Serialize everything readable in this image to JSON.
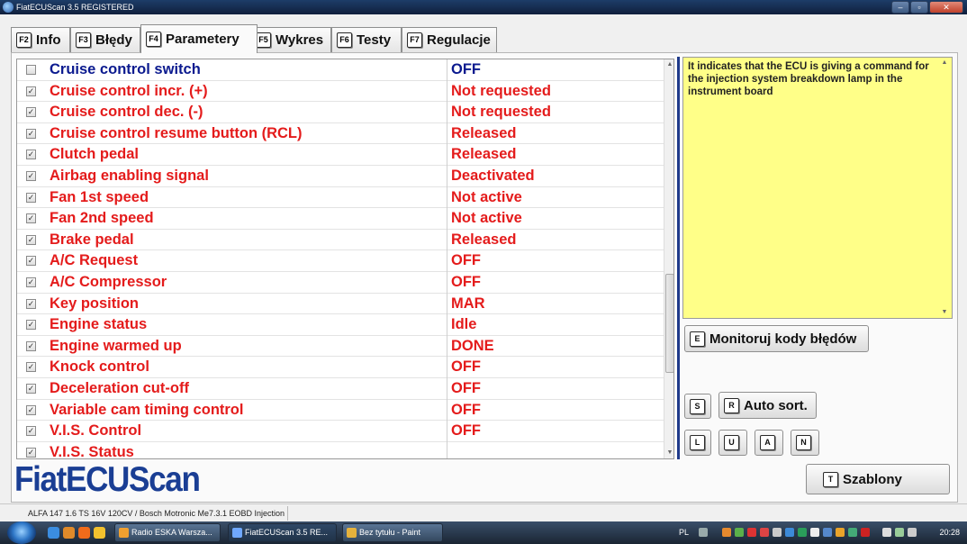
{
  "window": {
    "title": "FiatECUScan 3.5 REGISTERED",
    "controls": [
      "–",
      "▫",
      "✕"
    ]
  },
  "tabs": [
    {
      "key": "F2",
      "label": "Info"
    },
    {
      "key": "F3",
      "label": "Błędy"
    },
    {
      "key": "F4",
      "label": "Parametery"
    },
    {
      "key": "F5",
      "label": "Wykres"
    },
    {
      "key": "F6",
      "label": "Testy"
    },
    {
      "key": "F7",
      "label": "Regulacje"
    }
  ],
  "active_tab": "Parametery",
  "parameters": [
    {
      "name": "Cruise control switch",
      "value": "OFF",
      "checked": false,
      "color": "#0b1a8f"
    },
    {
      "name": "Cruise control incr. (+)",
      "value": "Not requested",
      "checked": true,
      "color": "#e41b1b"
    },
    {
      "name": "Cruise control dec. (-)",
      "value": "Not requested",
      "checked": true,
      "color": "#e41b1b"
    },
    {
      "name": "Cruise control resume button (RCL)",
      "value": "Released",
      "checked": true,
      "color": "#e41b1b"
    },
    {
      "name": "Clutch pedal",
      "value": "Released",
      "checked": true,
      "color": "#e41b1b"
    },
    {
      "name": "Airbag enabling signal",
      "value": "Deactivated",
      "checked": true,
      "color": "#e41b1b"
    },
    {
      "name": "Fan 1st speed",
      "value": "Not active",
      "checked": true,
      "color": "#e41b1b"
    },
    {
      "name": "Fan 2nd speed",
      "value": "Not active",
      "checked": true,
      "color": "#e41b1b"
    },
    {
      "name": "Brake pedal",
      "value": "Released",
      "checked": true,
      "color": "#e41b1b"
    },
    {
      "name": "A/C Request",
      "value": "OFF",
      "checked": true,
      "color": "#e41b1b"
    },
    {
      "name": "A/C Compressor",
      "value": "OFF",
      "checked": true,
      "color": "#e41b1b"
    },
    {
      "name": "Key position",
      "value": "MAR",
      "checked": true,
      "color": "#e41b1b"
    },
    {
      "name": "Engine status",
      "value": "Idle",
      "checked": true,
      "color": "#e41b1b"
    },
    {
      "name": "Engine warmed up",
      "value": "DONE",
      "checked": true,
      "color": "#e41b1b"
    },
    {
      "name": "Knock control",
      "value": "OFF",
      "checked": true,
      "color": "#e41b1b"
    },
    {
      "name": "Deceleration cut-off",
      "value": "OFF",
      "checked": true,
      "color": "#e41b1b"
    },
    {
      "name": "Variable cam timing control",
      "value": "OFF",
      "checked": true,
      "color": "#e41b1b"
    },
    {
      "name": "V.I.S. Control",
      "value": "OFF",
      "checked": true,
      "color": "#e41b1b"
    },
    {
      "name": "V.I.S. Status",
      "value": "",
      "checked": true,
      "color": "#e41b1b"
    }
  ],
  "description": "It indicates that the ECU is giving a command for the injection system breakdown lamp in the instrument board",
  "buttons": {
    "monitor": {
      "key": "E",
      "label": "Monitoruj kody błędów"
    },
    "s_key": "S",
    "auto_sort": {
      "key": "R",
      "label": "Auto sort."
    },
    "luan": [
      "L",
      "U",
      "A",
      "N"
    ],
    "templates": {
      "key": "T",
      "label": "Szablony"
    }
  },
  "logo": "FiatECUScan",
  "status_bar": "ALFA 147 1.6 TS 16V 120CV / Bosch Motronic Me7.3.1 EOBD Injection",
  "taskbar": {
    "tasks": [
      "Radio ESKA Warsza...",
      "FiatECUScan 3.5 RE...",
      "Bez tytułu - Paint"
    ],
    "language": "PL",
    "clock": "20:28"
  },
  "colors": {
    "accent": "#1f3a8a",
    "description_bg": "#ffff88",
    "value_red": "#e41b1b",
    "param_blue": "#0b1a8f"
  }
}
